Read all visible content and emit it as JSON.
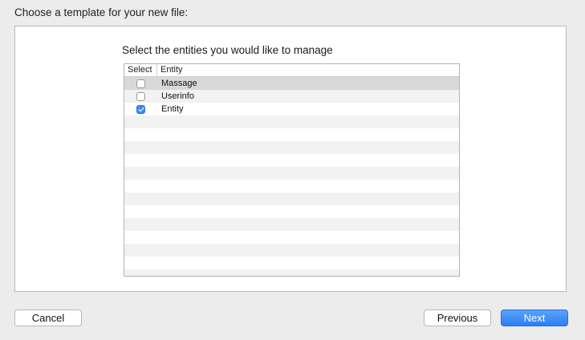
{
  "header": {
    "title": "Choose a template for your new file:"
  },
  "panel": {
    "prompt": "Select the entities you would like to manage",
    "table": {
      "columns": {
        "select": "Select",
        "entity": "Entity"
      },
      "rows": [
        {
          "entity": "Massage",
          "checked": false,
          "selected": true
        },
        {
          "entity": "Userinfo",
          "checked": false,
          "selected": false
        },
        {
          "entity": "Entity",
          "checked": true,
          "selected": false
        }
      ]
    }
  },
  "footer": {
    "cancel_label": "Cancel",
    "previous_label": "Previous",
    "next_label": "Next"
  },
  "colors": {
    "accent": "#3b8af7",
    "selected_row": "#d8d8d8",
    "stripe_row": "#f2f2f2"
  }
}
